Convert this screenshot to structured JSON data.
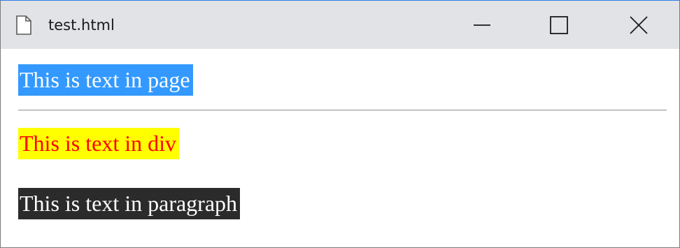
{
  "window": {
    "title": "test.html",
    "file_icon": "document-icon",
    "controls": {
      "minimize_icon": "minimize-icon",
      "maximize_icon": "maximize-icon",
      "close_icon": "close-icon"
    }
  },
  "page": {
    "body_text": "This is text in page",
    "div_text": "This is text in div",
    "paragraph_text": "This is text in paragraph"
  },
  "colors": {
    "titlebar": "#e1e3e6",
    "page_highlight": "#3399ff",
    "div_background": "#ffff00",
    "div_text": "#ff0000",
    "paragraph_background": "#2b2b2b",
    "paragraph_text": "#ffffff"
  }
}
